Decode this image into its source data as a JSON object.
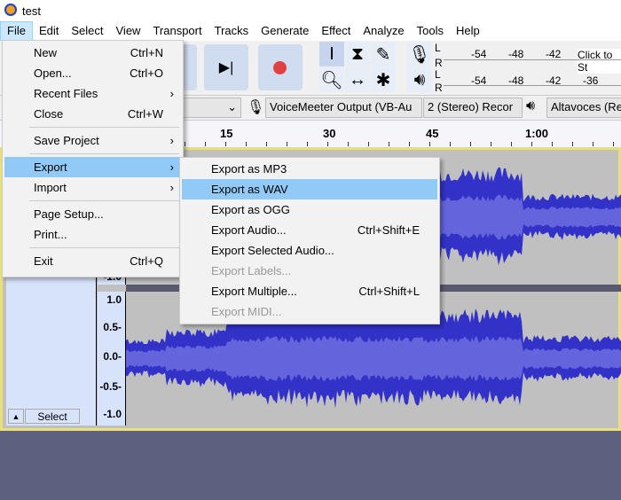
{
  "window": {
    "title": "test",
    "accent": "#91c9f7"
  },
  "menubar": [
    "File",
    "Edit",
    "Select",
    "View",
    "Transport",
    "Tracks",
    "Generate",
    "Effect",
    "Analyze",
    "Tools",
    "Help"
  ],
  "meters": {
    "rec_ticks": [
      "-54",
      "-48",
      "-42"
    ],
    "rec_hint": "Click to St",
    "play_ticks": [
      "-54",
      "-48",
      "-42",
      "-36"
    ],
    "L": "L",
    "R": "R"
  },
  "devices": {
    "input": "VoiceMeeter Output (VB-Au",
    "channels": "2 (Stereo) Recor",
    "output": "Altavoces (Rea"
  },
  "ruler": [
    "15",
    "30",
    "45",
    "1:00"
  ],
  "track": {
    "scale": [
      "1.0",
      "0.5-",
      "0.0-",
      "-0.5-",
      "-1.0"
    ],
    "top_scale_bottom": "-1.0",
    "select": "Select"
  },
  "file_menu": [
    {
      "label": "New",
      "key": "Ctrl+N"
    },
    {
      "label": "Open...",
      "key": "Ctrl+O"
    },
    {
      "label": "Recent Files",
      "sub": "›"
    },
    {
      "label": "Close",
      "key": "Ctrl+W"
    },
    {
      "label": "Save Project",
      "sub": "›"
    },
    {
      "label": "Export",
      "sub": "›",
      "active": true
    },
    {
      "label": "Import",
      "sub": "›"
    },
    {
      "label": "Page Setup..."
    },
    {
      "label": "Print..."
    },
    {
      "label": "Exit",
      "key": "Ctrl+Q"
    }
  ],
  "export_menu": [
    {
      "label": "Export as MP3"
    },
    {
      "label": "Export as WAV",
      "active": true
    },
    {
      "label": "Export as OGG"
    },
    {
      "label": "Export Audio...",
      "key": "Ctrl+Shift+E"
    },
    {
      "label": "Export Selected Audio..."
    },
    {
      "label": "Export Labels...",
      "disabled": true
    },
    {
      "label": "Export Multiple...",
      "key": "Ctrl+Shift+L"
    },
    {
      "label": "Export MIDI...",
      "disabled": true
    }
  ],
  "waveform_color": "#3232c8"
}
